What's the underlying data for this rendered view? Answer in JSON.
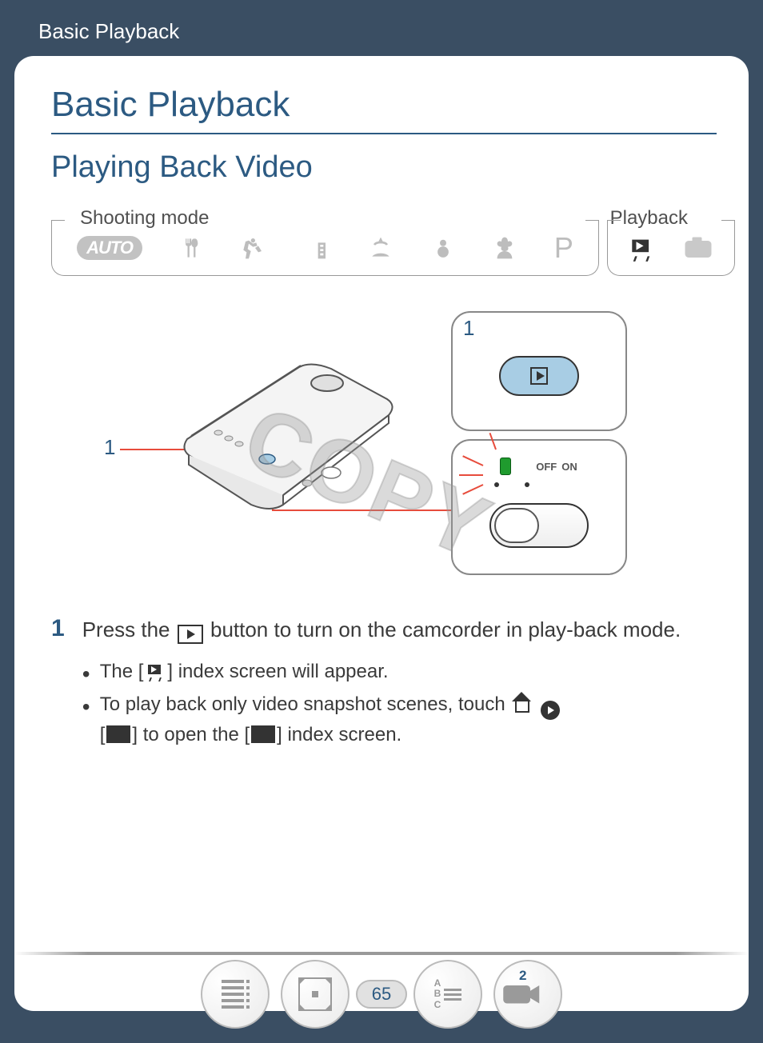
{
  "header": {
    "breadcrumb": "Basic Playback"
  },
  "title": "Basic Playback",
  "subtitle": "Playing Back Video",
  "mode_strip": {
    "shooting_label": "Shooting mode",
    "playback_label": "Playback",
    "auto_badge": "AUTO",
    "p_label": "P"
  },
  "illustration": {
    "callout_1": "1",
    "box1_num": "1",
    "off_label": "OFF",
    "on_label": "ON"
  },
  "watermark": "COPY",
  "step": {
    "num": "1",
    "line_a": "Press the ",
    "line_b": " button to turn on the camcorder in play-back mode.",
    "bullet1_a": "The [",
    "bullet1_b": "] index screen will appear.",
    "bullet2_a": "To play back only video snapshot scenes, touch ",
    "bullet2_b": " [",
    "bullet2_c": "] to open the [",
    "bullet2_d": "] index screen."
  },
  "nav": {
    "page_number": "65",
    "badge": "2",
    "abc": "A\nB\nC"
  }
}
